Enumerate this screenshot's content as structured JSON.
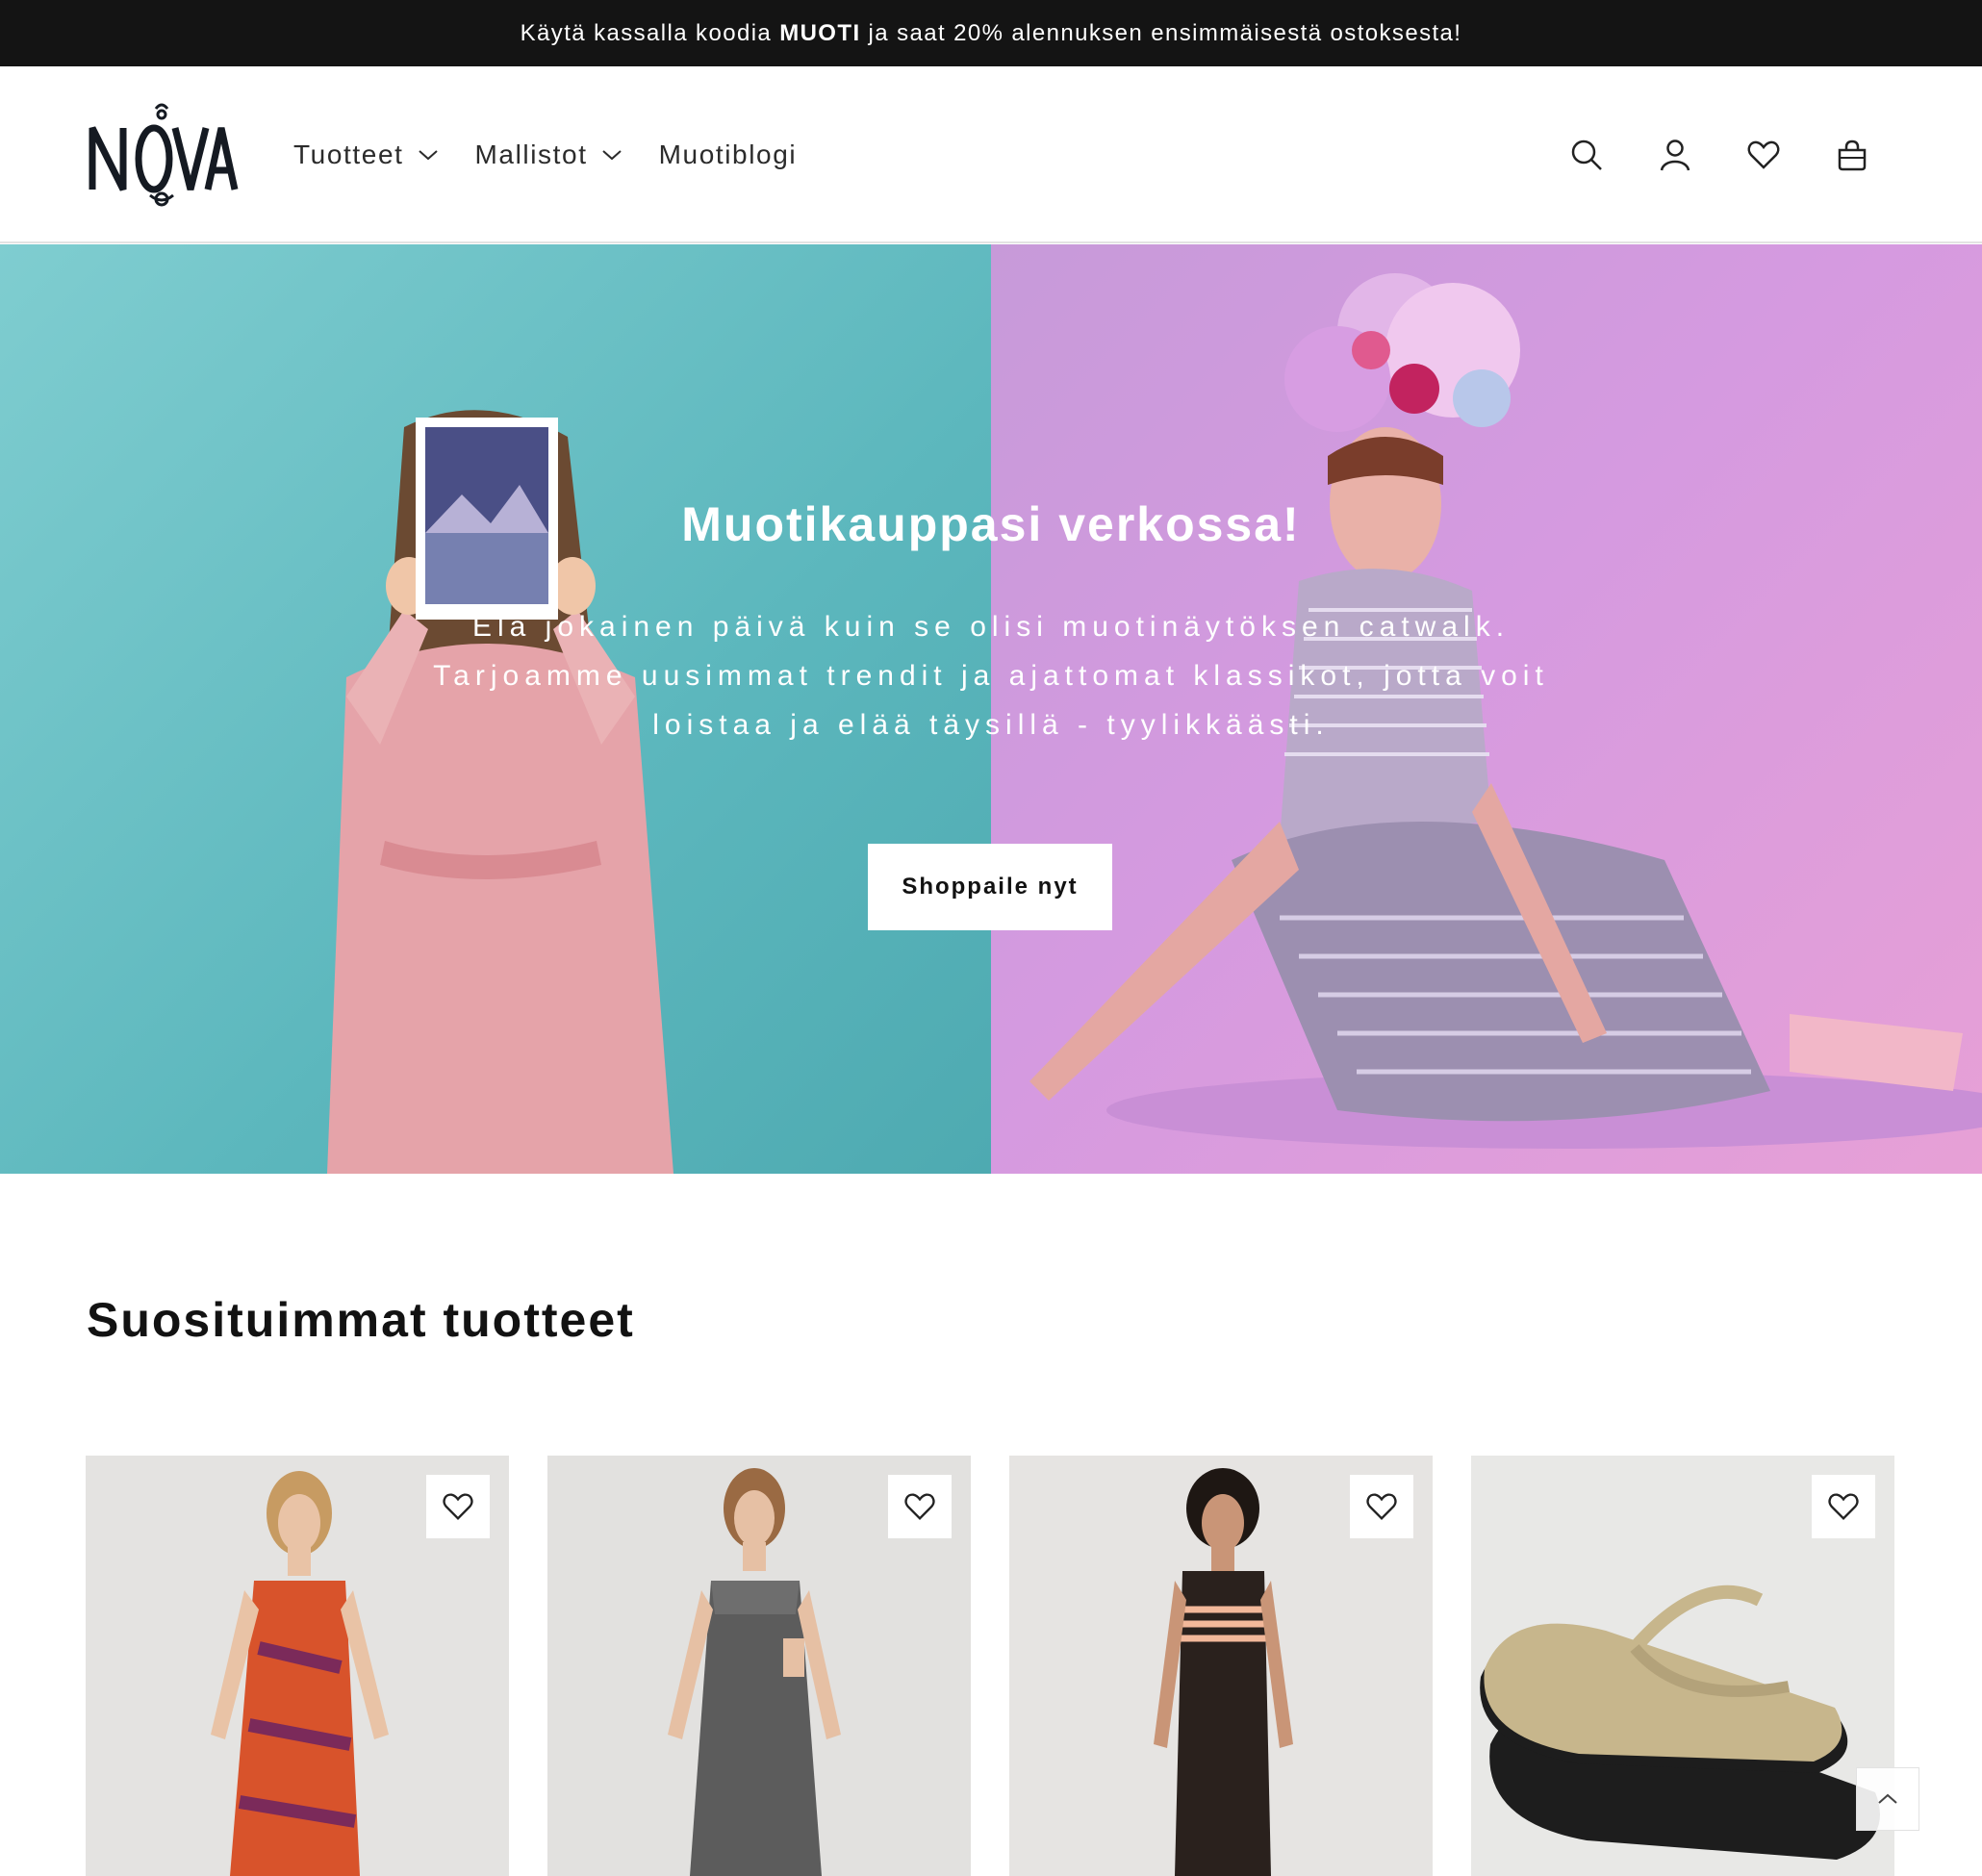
{
  "announcement": {
    "before": "Käytä kassalla koodia",
    "code": "MUOTI",
    "after": "ja saat 20% alennuksen ensimmäisestä ostoksesta!"
  },
  "header": {
    "logo_text": "NOVA",
    "nav": [
      {
        "label": "Tuotteet",
        "has_dropdown": true
      },
      {
        "label": "Mallistot",
        "has_dropdown": true
      },
      {
        "label": "Muotiblogi",
        "has_dropdown": false
      }
    ],
    "icons": [
      "search-icon",
      "account-icon",
      "wishlist-icon",
      "cart-icon"
    ]
  },
  "hero": {
    "title": "Muotikauppasi verkossa!",
    "subtitle": "Elä jokainen päivä kuin se olisi muotinäytöksen catwalk. Tarjoamme uusimmat trendit ja ajattomat klassikot, jotta voit loistaa ja elää täysillä - tyylikkäästi.",
    "button_label": "Shoppaile nyt",
    "left_bg": "#5cb7bd",
    "right_bg": "#d59ae0"
  },
  "section": {
    "title": "Suosituimmat tuotteet"
  },
  "products": [
    {
      "name": "floral-maxi-dress",
      "image_bg": "#e4e3e1",
      "accent": "#d8532b"
    },
    {
      "name": "printed-cutout-maxi-dress",
      "image_bg": "#e2e1df",
      "accent": "#5c5c5c"
    },
    {
      "name": "striped-knit-dress",
      "image_bg": "#e6e4e2",
      "accent": "#2a211d"
    },
    {
      "name": "flip-flops",
      "image_bg": "#e8e8e6",
      "accent": "#c7b68c"
    }
  ],
  "colors": {
    "announcement_bg": "#141414",
    "text": "#121212",
    "white": "#ffffff"
  }
}
